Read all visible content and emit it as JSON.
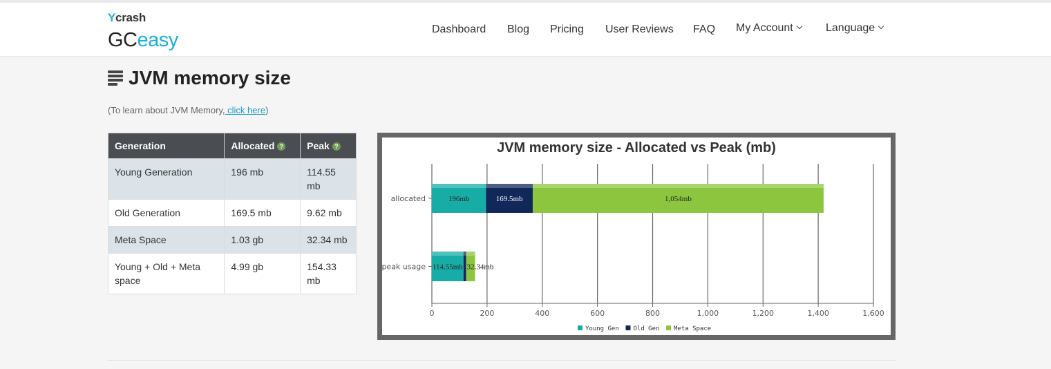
{
  "brand": {
    "ycrash": "crash",
    "gc": "GC",
    "easy": "easy"
  },
  "nav": {
    "items": [
      "Dashboard",
      "Blog",
      "Pricing",
      "User Reviews",
      "FAQ"
    ],
    "account": "My Account",
    "language": "Language"
  },
  "section": {
    "title": "JVM memory size",
    "learn_prefix": "(To learn about JVM Memory,",
    "learn_link": " click here",
    "learn_suffix": ")"
  },
  "table": {
    "headers": [
      "Generation",
      "Allocated",
      "Peak"
    ],
    "help_glyph": "?",
    "rows": [
      [
        "Young Generation",
        "196 mb",
        "114.55 mb"
      ],
      [
        "Old Generation",
        "169.5 mb",
        "9.62 mb"
      ],
      [
        "Meta Space",
        "1.03 gb",
        "32.34 mb"
      ],
      [
        "Young + Old + Meta space",
        "4.99 gb",
        "154.33 mb"
      ]
    ]
  },
  "chart_data": {
    "type": "bar",
    "orientation": "horizontal",
    "stacked": true,
    "title": "JVM memory size - Allocated vs Peak (mb)",
    "categories": [
      "allocated",
      "peak usage"
    ],
    "series": [
      {
        "name": "Young Gen",
        "color": "#17ada6",
        "values": [
          196,
          114.55
        ],
        "labels": [
          "196mb",
          "114.55mb"
        ]
      },
      {
        "name": "Old Gen",
        "color": "#12285a",
        "values": [
          169.5,
          9.62
        ],
        "labels": [
          "169.5mb",
          ""
        ]
      },
      {
        "name": "Meta Space",
        "color": "#8cc63f",
        "values": [
          1054,
          32.34
        ],
        "labels": [
          "1,054mb",
          "32.34mb"
        ]
      }
    ],
    "xlim": [
      0,
      1600
    ],
    "xticks": [
      0,
      200,
      400,
      600,
      800,
      1000,
      1200,
      1400,
      1600
    ],
    "xtick_labels": [
      "0",
      "200",
      "400",
      "600",
      "800",
      "1,000",
      "1,200",
      "1,400",
      "1,600"
    ],
    "grid": true,
    "legend_position": "bottom"
  }
}
